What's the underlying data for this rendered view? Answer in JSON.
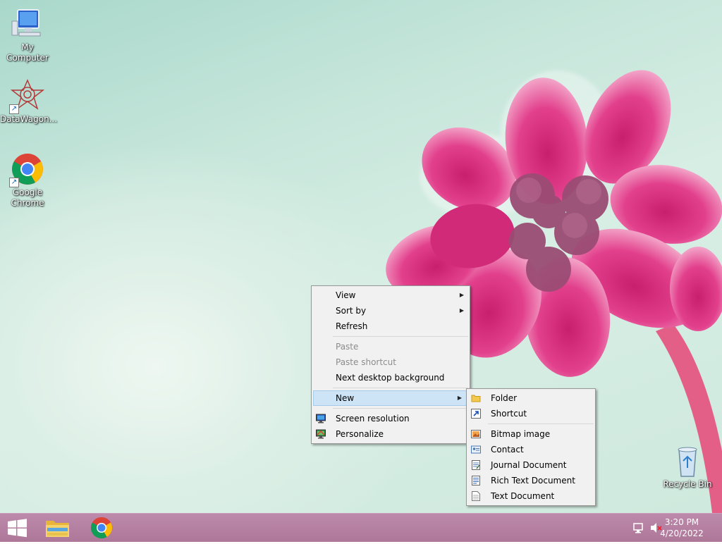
{
  "desktop": {
    "icons": [
      {
        "label": "My Computer",
        "icon": "computer-icon"
      },
      {
        "label": "DataWagon...",
        "icon": "datawagon-icon"
      },
      {
        "label": "Google Chrome",
        "icon": "chrome-icon"
      },
      {
        "label": "Recycle Bin",
        "icon": "recycle-bin-icon"
      }
    ]
  },
  "context_menu": {
    "view": "View",
    "sort_by": "Sort by",
    "refresh": "Refresh",
    "paste": "Paste",
    "paste_shortcut": "Paste shortcut",
    "next_background": "Next desktop background",
    "new": "New",
    "screen_resolution": "Screen resolution",
    "personalize": "Personalize"
  },
  "new_submenu": {
    "folder": "Folder",
    "shortcut": "Shortcut",
    "bitmap": "Bitmap image",
    "contact": "Contact",
    "journal": "Journal Document",
    "rich_text": "Rich Text Document",
    "text": "Text Document"
  },
  "taskbar": {
    "time": "3:20 PM",
    "date": "4/20/2022",
    "pinned": [
      "file-explorer-icon",
      "chrome-icon"
    ]
  },
  "colors": {
    "taskbar": "#b27d9e",
    "menu_bg": "#f1f1f1",
    "menu_highlight": "#cde4f7"
  }
}
